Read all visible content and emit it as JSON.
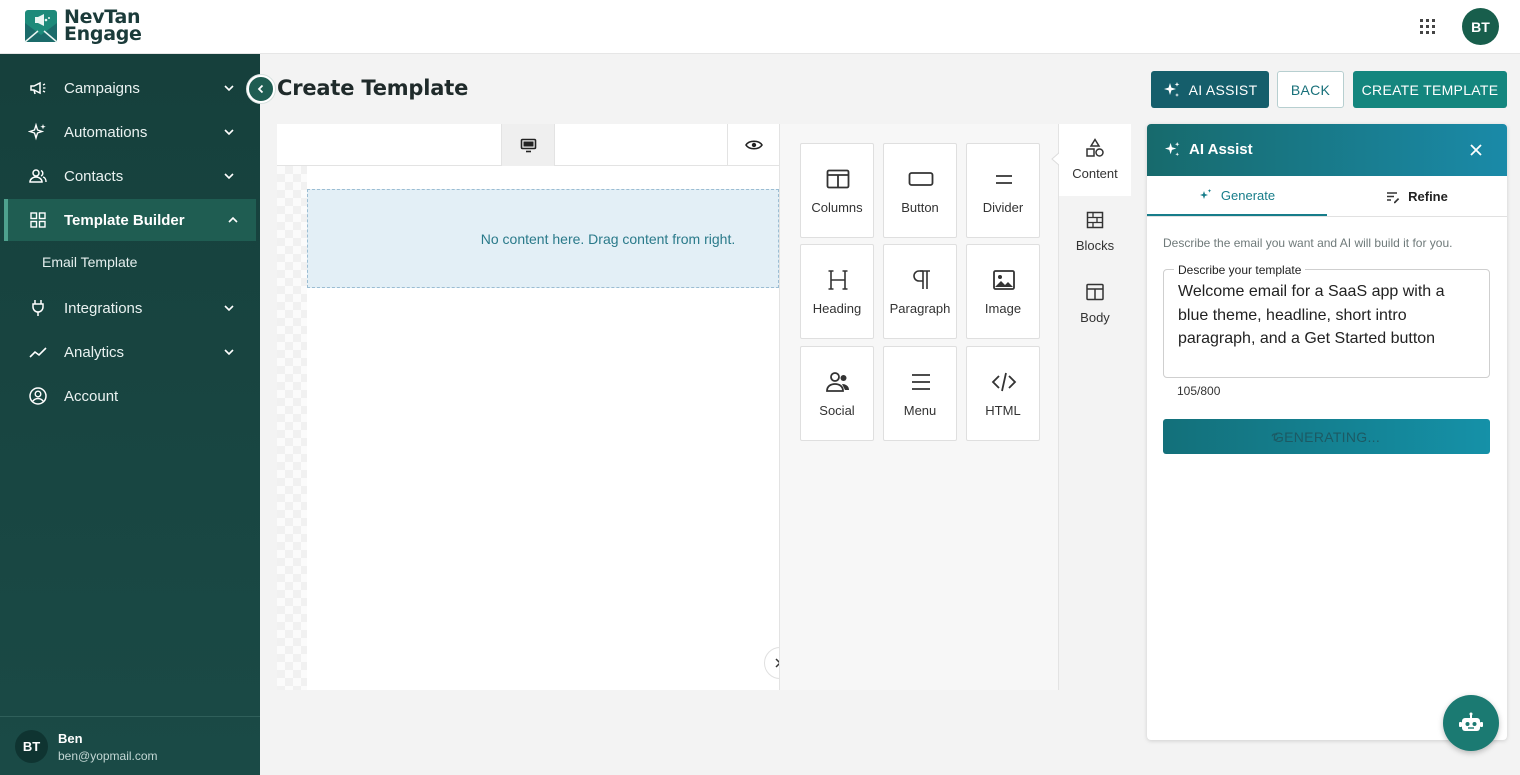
{
  "app": {
    "brand_line1": "NevTan",
    "brand_line2": "Engage",
    "user_initials": "BT"
  },
  "sidebar": {
    "items": [
      {
        "label": "Campaigns",
        "icon": "megaphone-icon"
      },
      {
        "label": "Automations",
        "icon": "sparkle-icon"
      },
      {
        "label": "Contacts",
        "icon": "people-icon"
      },
      {
        "label": "Template Builder",
        "icon": "grid-icon",
        "active": true
      },
      {
        "label": "Integrations",
        "icon": "plug-icon"
      },
      {
        "label": "Analytics",
        "icon": "trend-icon"
      },
      {
        "label": "Account",
        "icon": "account-circle-icon"
      }
    ],
    "sub_item": "Email Template",
    "user": {
      "initials": "BT",
      "name": "Ben",
      "email": "ben@yopmail.com"
    }
  },
  "header": {
    "title": "Create Template",
    "ai_assist_label": "AI ASSIST",
    "back_label": "BACK",
    "create_label": "CREATE TEMPLATE"
  },
  "canvas": {
    "empty_message": "No content here. Drag content from right."
  },
  "tools": {
    "items": [
      {
        "label": "Columns",
        "icon": "columns-icon"
      },
      {
        "label": "Button",
        "icon": "button-icon"
      },
      {
        "label": "Divider",
        "icon": "divider-icon"
      },
      {
        "label": "Heading",
        "icon": "heading-icon"
      },
      {
        "label": "Paragraph",
        "icon": "paragraph-icon"
      },
      {
        "label": "Image",
        "icon": "image-icon"
      },
      {
        "label": "Social",
        "icon": "social-icon"
      },
      {
        "label": "Menu",
        "icon": "menu-icon"
      },
      {
        "label": "HTML",
        "icon": "code-icon"
      }
    ],
    "tabs": [
      {
        "label": "Content",
        "icon": "shapes-icon",
        "active": true
      },
      {
        "label": "Blocks",
        "icon": "blocks-icon"
      },
      {
        "label": "Body",
        "icon": "body-layout-icon"
      }
    ]
  },
  "ai_panel": {
    "title": "AI Assist",
    "tab_generate": "Generate",
    "tab_refine": "Refine",
    "description": "Describe the email you want and AI will build it for you.",
    "field_label": "Describe your template",
    "prompt_text": "Welcome email for a SaaS app with a blue theme, headline, short intro paragraph, and a Get Started button",
    "char_count": "105/800",
    "generating_label": "GENERATING..."
  },
  "colors": {
    "sidebar_bg": "#16403c",
    "accent_teal": "#14867e",
    "ai_blue": "#155e6b"
  }
}
